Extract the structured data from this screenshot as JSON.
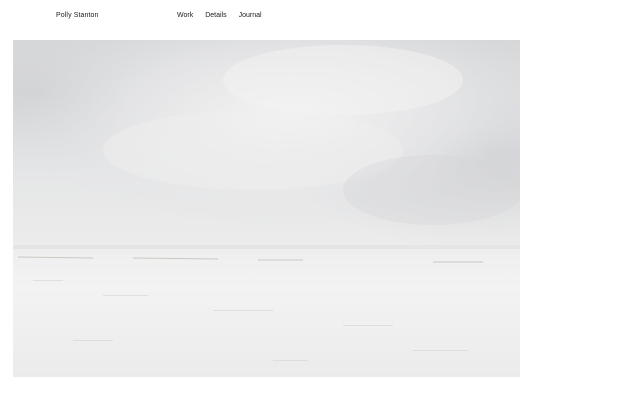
{
  "header": {
    "site_name": "Polly Stanton",
    "nav": {
      "work": "Work",
      "details": "Details",
      "journal": "Journal"
    }
  },
  "hero": {
    "subject": "snowy plain under overcast sky"
  }
}
